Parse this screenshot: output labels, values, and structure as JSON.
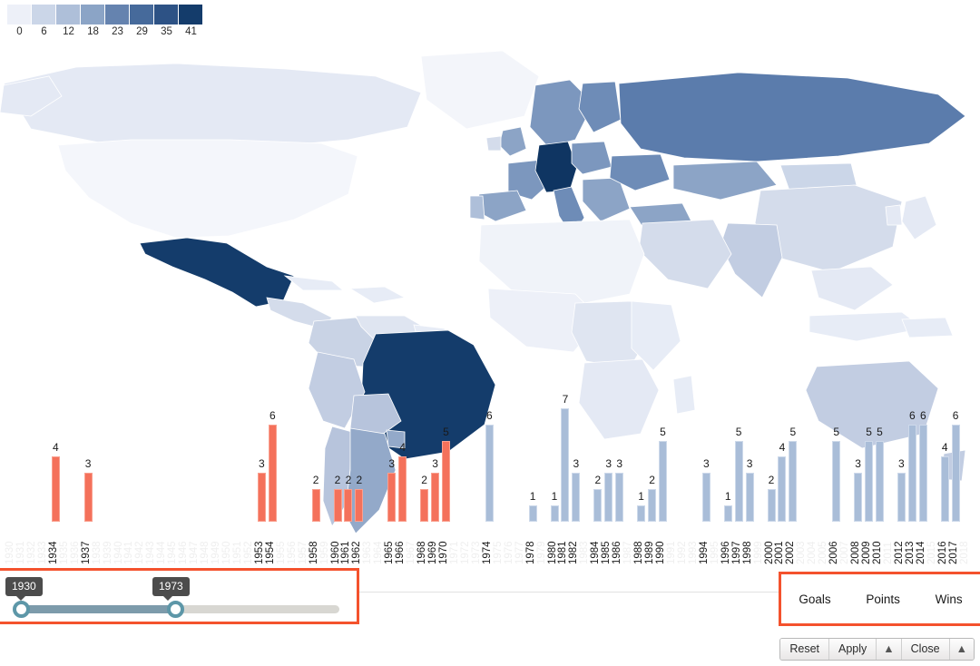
{
  "legend": {
    "name": "choropleth-color-scale",
    "ticks": [
      "0",
      "6",
      "12",
      "18",
      "23",
      "29",
      "35",
      "41"
    ],
    "colors": [
      "#EDF0F8",
      "#CBD6E8",
      "#AEBFD9",
      "#8BA4C6",
      "#6583AF",
      "#466A9B",
      "#2D5285",
      "#143C6B"
    ]
  },
  "map": {
    "name": "world-choropleth-map",
    "highlight_dark": [
      "Germany",
      "Brazil",
      "Mexico"
    ],
    "dark_color": "#143C6B"
  },
  "chart_data": {
    "type": "bar",
    "title": "",
    "xlabel": "",
    "ylabel": "",
    "ylim": [
      0,
      7
    ],
    "grid": false,
    "legend_position": "none",
    "colors": {
      "selected": "#F4715B",
      "unselected": "#A9BDD8"
    },
    "year_range": [
      1930,
      2018
    ],
    "categories": [
      "1930",
      "1931",
      "1932",
      "1933",
      "1934",
      "1935",
      "1936",
      "1937",
      "1938",
      "1939",
      "1940",
      "1941",
      "1942",
      "1943",
      "1944",
      "1945",
      "1946",
      "1947",
      "1948",
      "1949",
      "1950",
      "1951",
      "1952",
      "1953",
      "1954",
      "1955",
      "1956",
      "1957",
      "1958",
      "1959",
      "1960",
      "1961",
      "1962",
      "1963",
      "1964",
      "1965",
      "1966",
      "1967",
      "1968",
      "1969",
      "1970",
      "1971",
      "1972",
      "1973",
      "1974",
      "1975",
      "1976",
      "1977",
      "1978",
      "1979",
      "1980",
      "1981",
      "1982",
      "1983",
      "1984",
      "1985",
      "1986",
      "1987",
      "1988",
      "1989",
      "1990",
      "1991",
      "1992",
      "1993",
      "1994",
      "1995",
      "1996",
      "1997",
      "1998",
      "1999",
      "2000",
      "2001",
      "2002",
      "2003",
      "2004",
      "2005",
      "2006",
      "2007",
      "2008",
      "2009",
      "2010",
      "2011",
      "2012",
      "2013",
      "2014",
      "2015",
      "2016",
      "2017",
      "2018"
    ],
    "values": [
      0,
      0,
      0,
      0,
      4,
      0,
      0,
      3,
      0,
      0,
      0,
      0,
      0,
      0,
      0,
      0,
      0,
      0,
      0,
      0,
      0,
      0,
      0,
      3,
      6,
      0,
      0,
      0,
      2,
      0,
      2,
      2,
      2,
      0,
      0,
      3,
      4,
      0,
      2,
      3,
      5,
      0,
      0,
      0,
      6,
      0,
      0,
      0,
      1,
      0,
      1,
      7,
      3,
      0,
      2,
      3,
      3,
      0,
      1,
      2,
      5,
      0,
      0,
      0,
      3,
      0,
      1,
      5,
      3,
      0,
      2,
      4,
      5,
      0,
      0,
      0,
      5,
      0,
      3,
      5,
      5,
      0,
      3,
      6,
      6,
      0,
      4,
      6,
      0
    ],
    "selected_years": [
      "1934",
      "1937",
      "1953",
      "1954",
      "1958",
      "1960",
      "1961",
      "1962",
      "1965",
      "1966",
      "1968",
      "1969",
      "1970"
    ]
  },
  "slider": {
    "name": "year-range-slider",
    "min_label": "1930",
    "max_label": "1973",
    "domain_min": 1930,
    "domain_max": 2018,
    "highlight_color": "#F4522D"
  },
  "metrics": {
    "name": "metric-selector",
    "options": [
      {
        "label": "Goals"
      },
      {
        "label": "Points"
      },
      {
        "label": "Wins"
      }
    ],
    "highlight_color": "#F4522D"
  },
  "buttons": {
    "reset": "Reset",
    "apply": "Apply",
    "close": "Close",
    "caret": "▲"
  }
}
